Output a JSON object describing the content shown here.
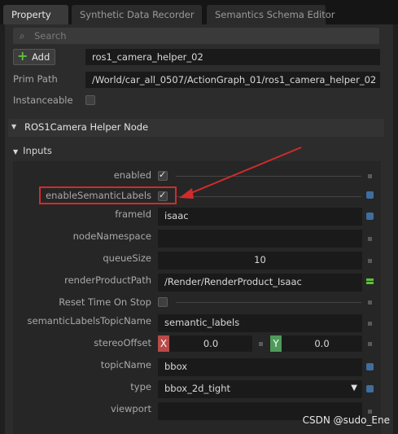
{
  "tabs": [
    {
      "label": "Property",
      "active": true
    },
    {
      "label": "Synthetic Data Recorder",
      "active": false
    },
    {
      "label": "Semantics Schema Editor",
      "active": false
    }
  ],
  "search": {
    "placeholder": "Search"
  },
  "header": {
    "add_label": "Add",
    "prim_name": "ros1_camera_helper_02",
    "prim_path_label": "Prim Path",
    "prim_path": "/World/car_all_0507/ActionGraph_01/ros1_camera_helper_02",
    "instanceable_label": "Instanceable"
  },
  "node": {
    "title": "ROS1Camera Helper Node",
    "inputs_label": "Inputs",
    "fields": {
      "enabled": {
        "label": "enabled",
        "checked": true
      },
      "enableSemanticLabels": {
        "label": "enableSemanticLabels",
        "checked": true
      },
      "frameId": {
        "label": "frameId",
        "value": "isaac"
      },
      "nodeNamespace": {
        "label": "nodeNamespace",
        "value": ""
      },
      "queueSize": {
        "label": "queueSize",
        "value": "10"
      },
      "renderProductPath": {
        "label": "renderProductPath",
        "value": "/Render/RenderProduct_Isaac"
      },
      "resetTimeOnStop": {
        "label": "Reset Time On Stop",
        "checked": false
      },
      "semanticLabelsTopicName": {
        "label": "semanticLabelsTopicName",
        "value": "semantic_labels"
      },
      "stereoOffset": {
        "label": "stereoOffset",
        "x_label": "X",
        "x": "0.0",
        "y_label": "Y",
        "y": "0.0"
      },
      "topicName": {
        "label": "topicName",
        "value": "bbox"
      },
      "type": {
        "label": "type",
        "value": "bbox_2d_tight"
      },
      "viewport": {
        "label": "viewport",
        "value": ""
      }
    }
  },
  "watermark": "CSDN @sudo_Ene",
  "colors": {
    "accent": "#3f6e9e",
    "highlight": "#d12b2b",
    "x_axis": "#b94a48",
    "y_axis": "#4e9a5a"
  }
}
